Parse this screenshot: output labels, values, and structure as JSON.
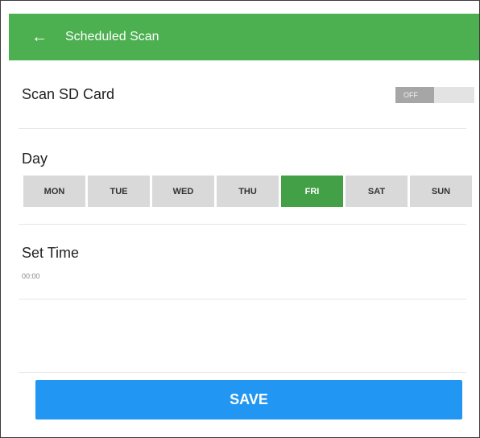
{
  "appbar": {
    "back_icon": "arrow-left-icon",
    "back_glyph": "←",
    "title": "Scheduled Scan"
  },
  "scan_sd": {
    "label": "Scan SD Card",
    "toggle_state": "OFF"
  },
  "day": {
    "label": "Day",
    "options": [
      {
        "label": "MON",
        "selected": false
      },
      {
        "label": "TUE",
        "selected": false
      },
      {
        "label": "WED",
        "selected": false
      },
      {
        "label": "THU",
        "selected": false
      },
      {
        "label": "FRI",
        "selected": true
      },
      {
        "label": "SAT",
        "selected": false
      },
      {
        "label": "SUN",
        "selected": false
      }
    ]
  },
  "set_time": {
    "label": "Set Time",
    "value": "00:00"
  },
  "save": {
    "label": "SAVE"
  },
  "colors": {
    "appbar": "#4caf50",
    "selected_day": "#43a047",
    "save_button": "#2196f3",
    "unselected_day": "#d9d9d9"
  }
}
